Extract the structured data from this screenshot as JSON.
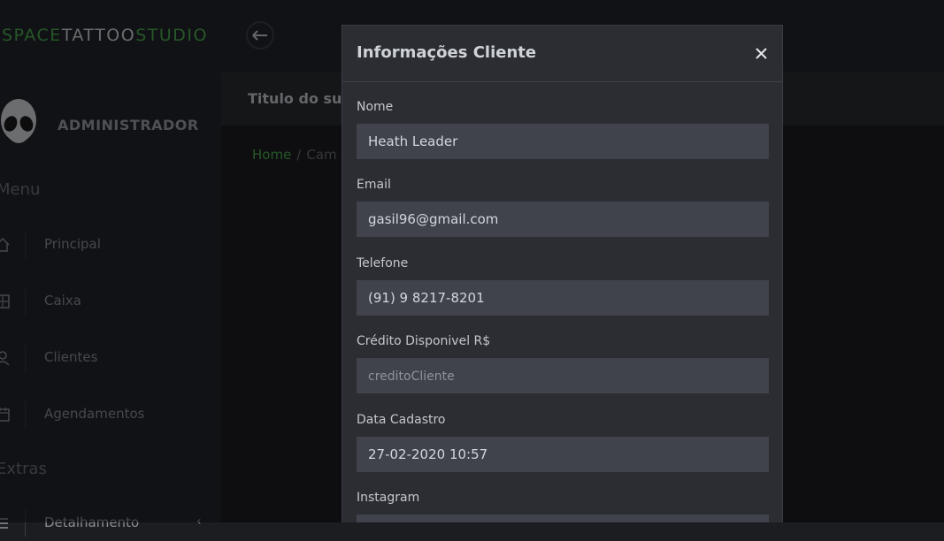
{
  "brand": {
    "part1": "SPACE",
    "part2": "TATTOO",
    "part3": "STUDIO"
  },
  "sidebar": {
    "role": "ADMINISTRADOR",
    "menu_heading": "Menu",
    "items": [
      {
        "label": "Principal",
        "icon": "home-icon"
      },
      {
        "label": "Caixa",
        "icon": "cash-register-icon"
      },
      {
        "label": "Clientes",
        "icon": "user-icon"
      },
      {
        "label": "Agendamentos",
        "icon": "calendar-icon"
      }
    ],
    "extras_heading": "Extras",
    "extras_items": [
      {
        "label": "Detalhamento",
        "icon": "details-icon"
      }
    ]
  },
  "subheader": {
    "title": "Titulo do subtitulo"
  },
  "breadcrumb": {
    "home": "Home",
    "separator": "/",
    "current": "Cam"
  },
  "modal": {
    "title": "Informações Cliente",
    "close_label": "×",
    "fields": {
      "nome": {
        "label": "Nome",
        "value": "Heath Leader"
      },
      "email": {
        "label": "Email",
        "value": "gasil96@gmail.com"
      },
      "telefone": {
        "label": "Telefone",
        "value": "(91) 9 8217-8201"
      },
      "credito": {
        "label": "Crédito Disponivel R$",
        "value": "",
        "placeholder": "creditoCliente"
      },
      "data_cadastro": {
        "label": "Data Cadastro",
        "value": "27-02-2020 10:57"
      },
      "instagram": {
        "label": "Instagram",
        "value": ""
      }
    }
  },
  "colors": {
    "accent": "#4caf50",
    "background": "#1c1d21",
    "modal_bg": "#2b2d33",
    "input_bg": "#40434b"
  }
}
